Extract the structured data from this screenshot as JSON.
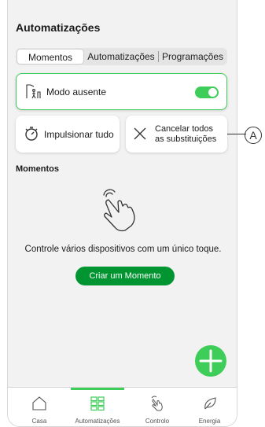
{
  "header": {
    "title": "Automatizações"
  },
  "tabs": [
    {
      "label": "Momentos",
      "active": true
    },
    {
      "label": "Automatizações",
      "active": false
    },
    {
      "label": "Programações",
      "active": false
    }
  ],
  "mode_card": {
    "label": "Modo ausente",
    "toggle_on": true,
    "icon": "away-mode-icon"
  },
  "boost_card": {
    "label": "Impulsionar tudo",
    "icon": "timer-icon"
  },
  "cancel_card": {
    "line1": "Cancelar todos",
    "line2": "as substituições",
    "icon": "close-icon"
  },
  "section": {
    "title": "Momentos"
  },
  "empty_state": {
    "text": "Controle vários dispositivos com um único toque.",
    "button_label": "Criar um Momento",
    "icon": "tap-hand-icon"
  },
  "fab": {
    "icon": "plus-icon"
  },
  "nav": {
    "items": [
      {
        "label": "Casa",
        "icon": "house-icon",
        "active": false
      },
      {
        "label": "Automatizações",
        "icon": "grid-icon",
        "active": true
      },
      {
        "label": "Controlo",
        "icon": "hand-icon",
        "active": false
      },
      {
        "label": "Energia",
        "icon": "leaf-icon",
        "active": false
      }
    ]
  },
  "callout": {
    "letter": "A"
  },
  "colors": {
    "accent": "#3dcd58",
    "button": "#009530",
    "background": "#f2f2f2"
  }
}
